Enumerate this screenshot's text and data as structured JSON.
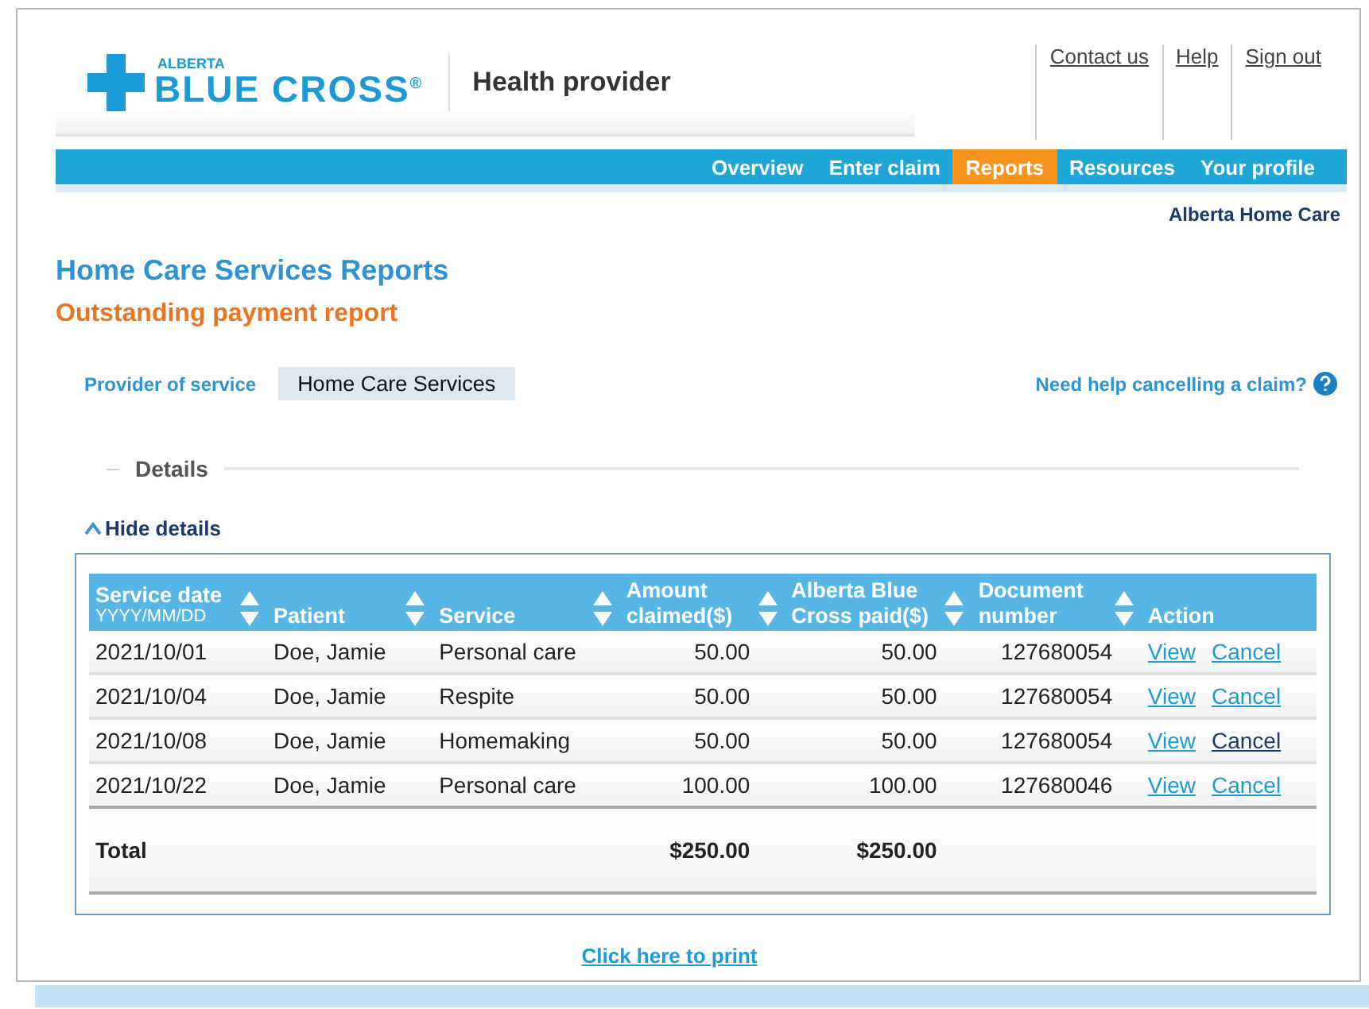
{
  "logo": {
    "small": "ALBERTA",
    "main": "BLUE CROSS",
    "mark": "®"
  },
  "portal_title": "Health provider",
  "top_links": [
    "Contact us",
    "Help",
    "Sign out"
  ],
  "nav": [
    {
      "label": "Overview",
      "selected": false
    },
    {
      "label": "Enter claim",
      "selected": false
    },
    {
      "label": "Reports",
      "selected": true
    },
    {
      "label": "Resources",
      "selected": false
    },
    {
      "label": "Your profile",
      "selected": false
    }
  ],
  "organization": "Alberta Home Care",
  "title": "Home Care Services Reports",
  "subtitle": "Outstanding payment report",
  "provider": {
    "label": "Provider of service",
    "value": "Home Care Services"
  },
  "help_link": "Need help cancelling a claim?",
  "details": {
    "legend": "Details",
    "toggle": "Hide details",
    "expanded": true
  },
  "table": {
    "columns": [
      {
        "label": "Service date",
        "sublabel": "YYYY/MM/DD",
        "sortable": true
      },
      {
        "label": "Patient",
        "sortable": true
      },
      {
        "label": "Service",
        "sortable": true
      },
      {
        "label": "Amount claimed($)",
        "sortable": true
      },
      {
        "label": "Alberta Blue Cross paid($)",
        "sortable": true
      },
      {
        "label": "Document number",
        "sortable": true
      },
      {
        "label": "Action",
        "sortable": false
      }
    ],
    "rows": [
      {
        "cells": [
          "2021/10/01",
          "Doe, Jamie",
          "Personal care",
          "50.00",
          "50.00",
          "127680054"
        ],
        "actions": [
          {
            "label": "View",
            "hovered": false
          },
          {
            "label": "Cancel",
            "hovered": false
          }
        ]
      },
      {
        "cells": [
          "2021/10/04",
          "Doe, Jamie",
          "Respite",
          "50.00",
          "50.00",
          "127680054"
        ],
        "actions": [
          {
            "label": "View",
            "hovered": false
          },
          {
            "label": "Cancel",
            "hovered": false
          }
        ]
      },
      {
        "cells": [
          "2021/10/08",
          "Doe, Jamie",
          "Homemaking",
          "50.00",
          "50.00",
          "127680054"
        ],
        "actions": [
          {
            "label": "View",
            "hovered": false
          },
          {
            "label": "Cancel",
            "hovered": true
          }
        ]
      },
      {
        "cells": [
          "2021/10/22",
          "Doe, Jamie",
          "Personal care",
          "100.00",
          "100.00",
          "127680046"
        ],
        "actions": [
          {
            "label": "View",
            "hovered": false
          },
          {
            "label": "Cancel",
            "hovered": false
          }
        ]
      }
    ],
    "total": {
      "label": "Total",
      "amount_claimed": "$250.00",
      "paid": "$250.00"
    }
  },
  "print_link": "Click here to print"
}
